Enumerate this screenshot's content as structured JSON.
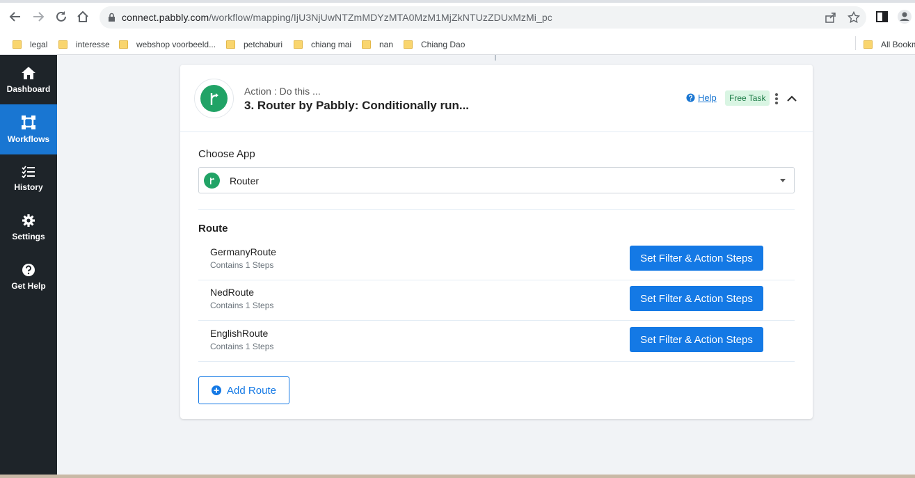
{
  "browser": {
    "url_host": "connect.pabbly.com",
    "url_path": "/workflow/mapping/IjU3NjUwNTZmMDYzMTA0MzM1MjZkNTUzZDUxMzMi_pc",
    "bookmarks": [
      "legal",
      "interesse",
      "webshop voorbeeld...",
      "petchaburi",
      "chiang mai",
      "nan",
      "Chiang Dao"
    ],
    "all_bookmarks": "All Bookm"
  },
  "sidebar": {
    "items": [
      {
        "label": "Dashboard",
        "icon": "home-icon"
      },
      {
        "label": "Workflows",
        "icon": "workflow-icon"
      },
      {
        "label": "History",
        "icon": "history-icon"
      },
      {
        "label": "Settings",
        "icon": "gear-icon"
      },
      {
        "label": "Get Help",
        "icon": "question-icon"
      }
    ]
  },
  "step": {
    "subtitle": "Action : Do this ...",
    "title": "3. Router by Pabbly: Conditionally run...",
    "help_label": "Help",
    "badge": "Free Task"
  },
  "choose_app": {
    "label": "Choose App",
    "selected": "Router"
  },
  "routes": {
    "heading": "Route",
    "items": [
      {
        "name": "GermanyRoute",
        "steps": "Contains 1 Steps",
        "button": "Set Filter & Action Steps"
      },
      {
        "name": "NedRoute",
        "steps": "Contains 1 Steps",
        "button": "Set Filter & Action Steps"
      },
      {
        "name": "EnglishRoute",
        "steps": "Contains 1 Steps",
        "button": "Set Filter & Action Steps"
      }
    ],
    "add_label": "Add Route"
  },
  "colors": {
    "sidebar_bg": "#1e2429",
    "active": "#1976d2",
    "primary_button": "#1479e5",
    "app_green": "#21a366"
  }
}
